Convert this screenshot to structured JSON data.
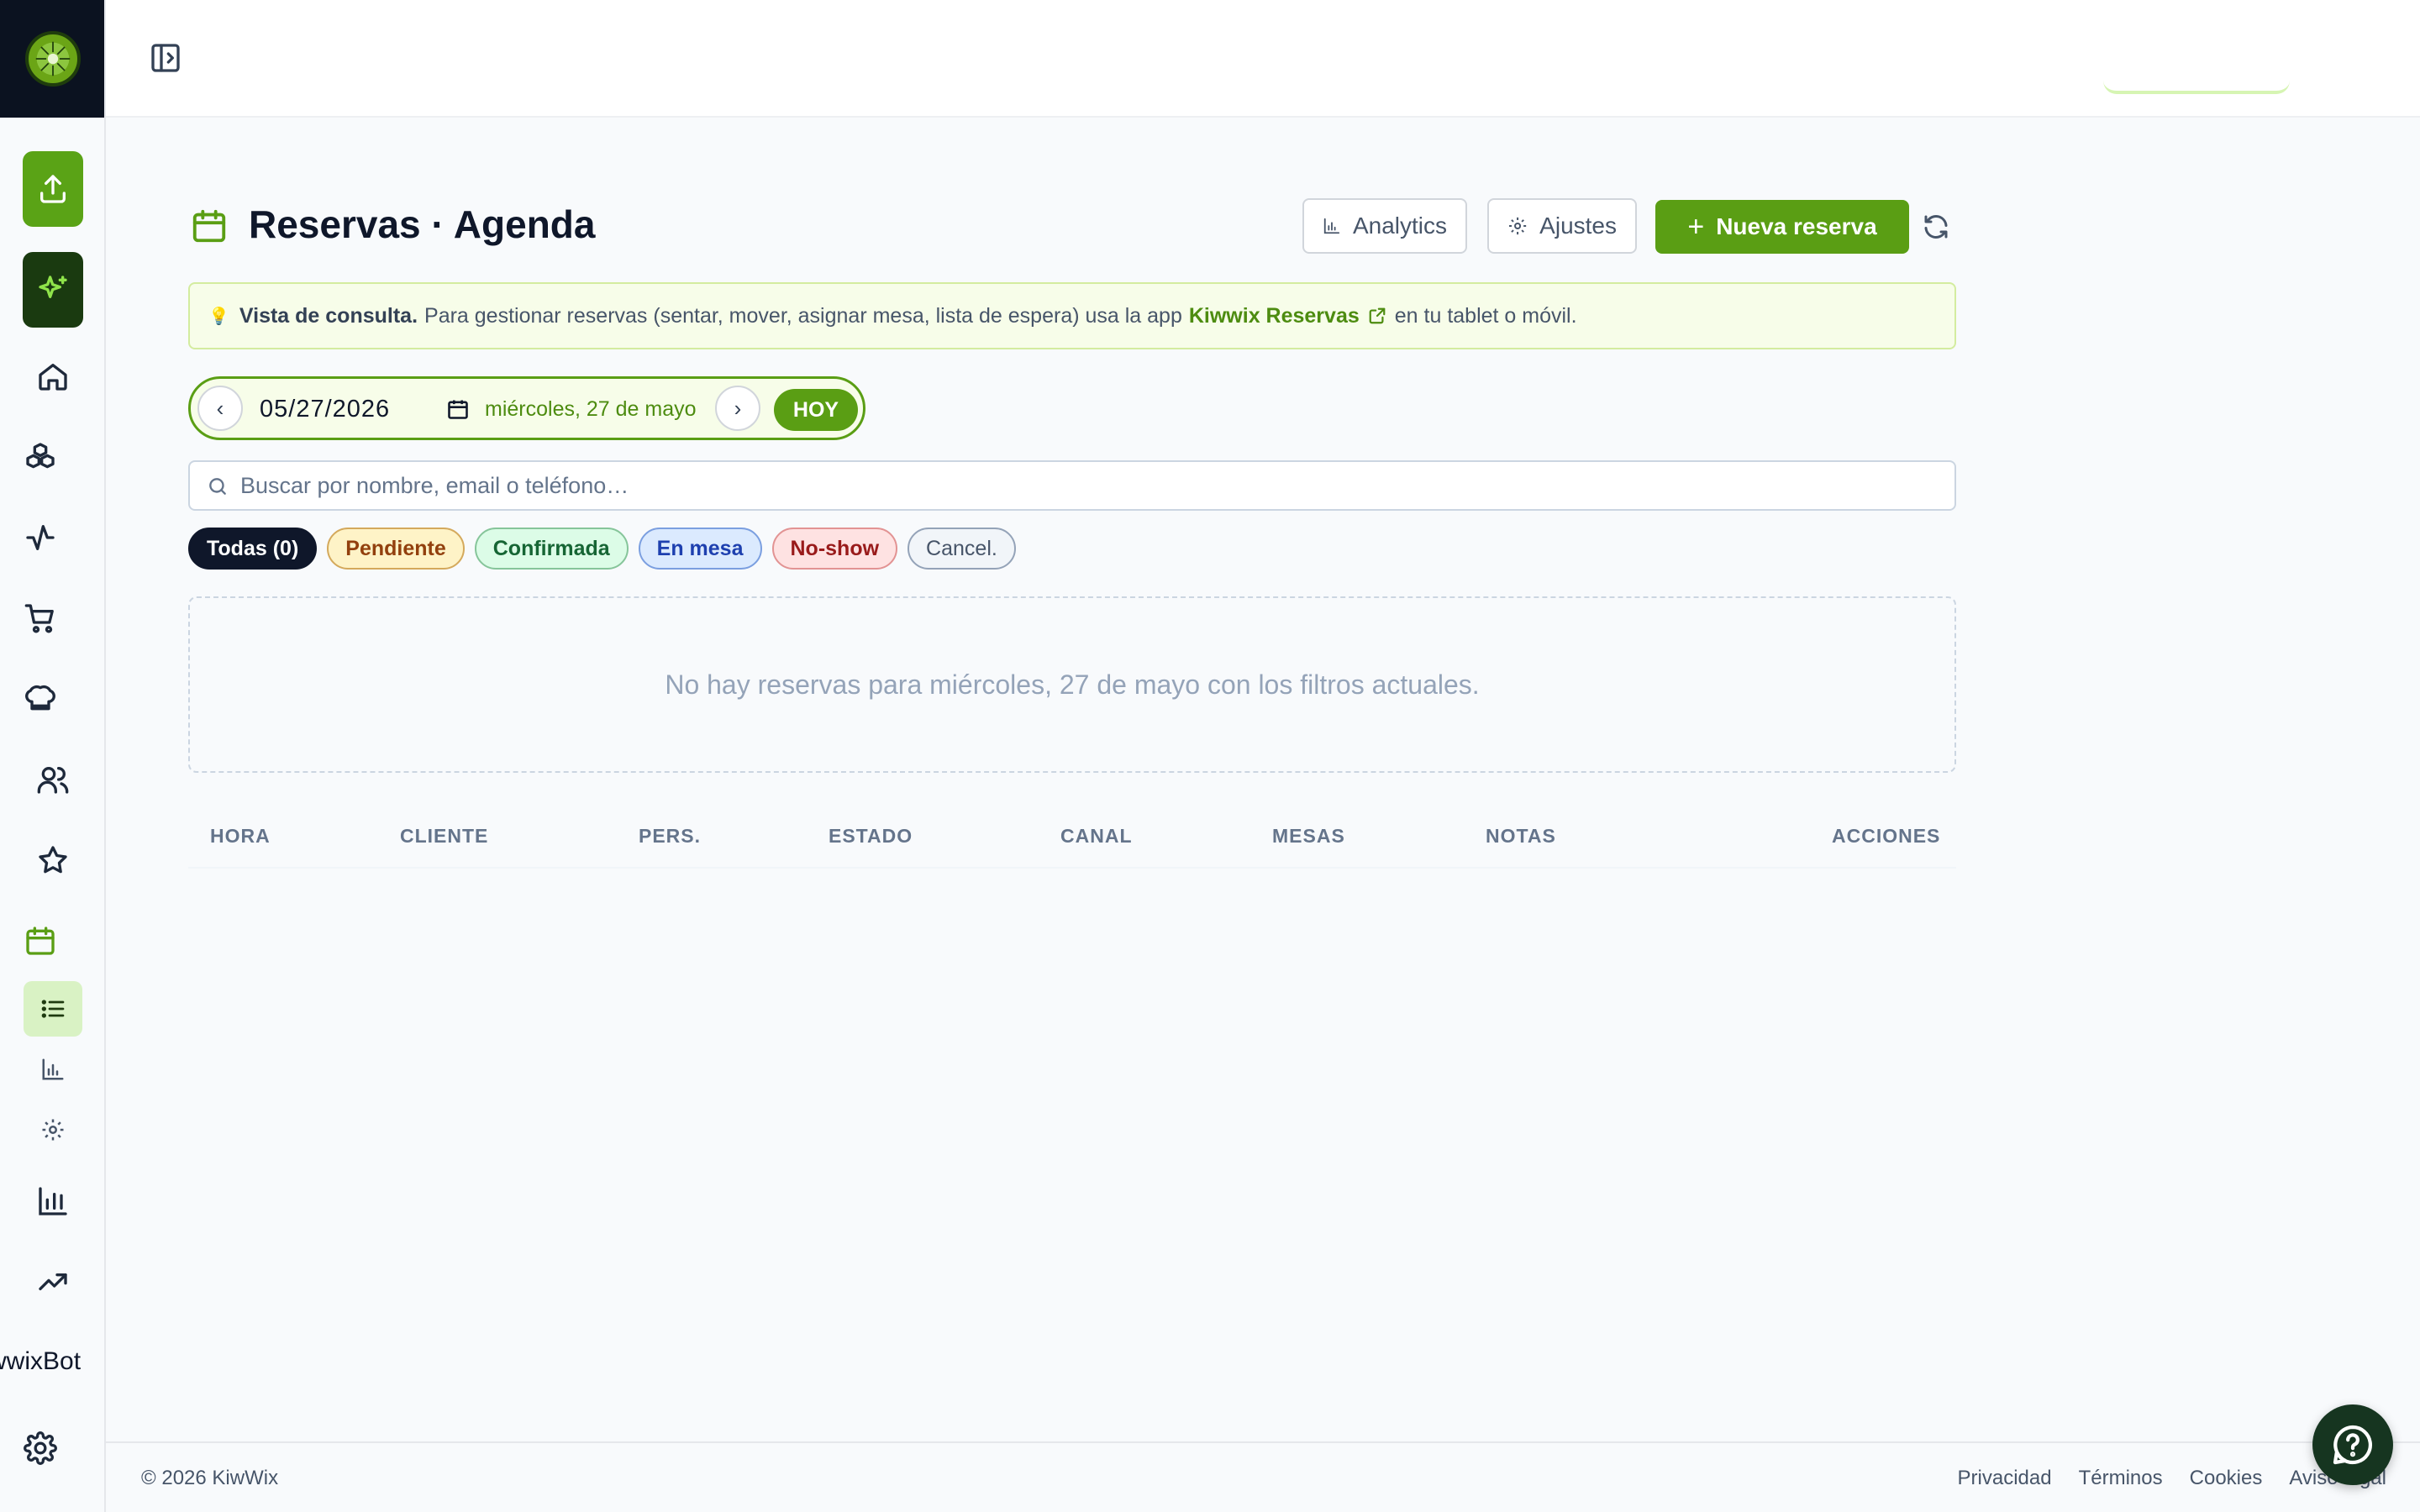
{
  "sidebar": {
    "bot_label": "wwixBot",
    "icons": [
      "upload-icon",
      "sparkles-icon",
      "home-icon",
      "boxes-icon",
      "activity-icon",
      "cart-icon",
      "chef-hat-icon",
      "users-icon",
      "star-icon",
      "calendar-icon",
      "list-icon",
      "bar-chart-icon",
      "gear-icon",
      "chart-icon",
      "trending-icon",
      "gear-icon"
    ]
  },
  "header": {
    "title": "Reservas · Agenda",
    "analytics_label": "Analytics",
    "settings_label": "Ajustes",
    "new_label": "Nueva reserva"
  },
  "notice": {
    "bold": "Vista de consulta.",
    "text": "Para gestionar reservas (sentar, mover, asignar mesa, lista de espera) usa la app",
    "app_name": "Kiwwix Reservas",
    "tail": "en tu tablet o móvil."
  },
  "date_nav": {
    "date_value": "05/27/2026",
    "date_text": "miércoles, 27 de mayo",
    "today_label": "HOY"
  },
  "search": {
    "placeholder": "Buscar por nombre, email o teléfono…"
  },
  "filters": [
    {
      "label": "Todas (0)"
    },
    {
      "label": "Pendiente"
    },
    {
      "label": "Confirmada"
    },
    {
      "label": "En mesa"
    },
    {
      "label": "No-show"
    },
    {
      "label": "Cancel."
    }
  ],
  "empty_message": "No hay reservas para miércoles, 27 de mayo con los filtros actuales.",
  "table": {
    "columns": [
      "HORA",
      "CLIENTE",
      "PERS.",
      "ESTADO",
      "CANAL",
      "MESAS",
      "NOTAS",
      "ACCIONES"
    ]
  },
  "footer": {
    "copyright": "© 2026 KiwWix",
    "links": [
      "Privacidad",
      "Términos",
      "Cookies",
      "Aviso legal"
    ]
  },
  "colors": {
    "brand_green": "#5a9e14",
    "dark": "#0b1220"
  }
}
